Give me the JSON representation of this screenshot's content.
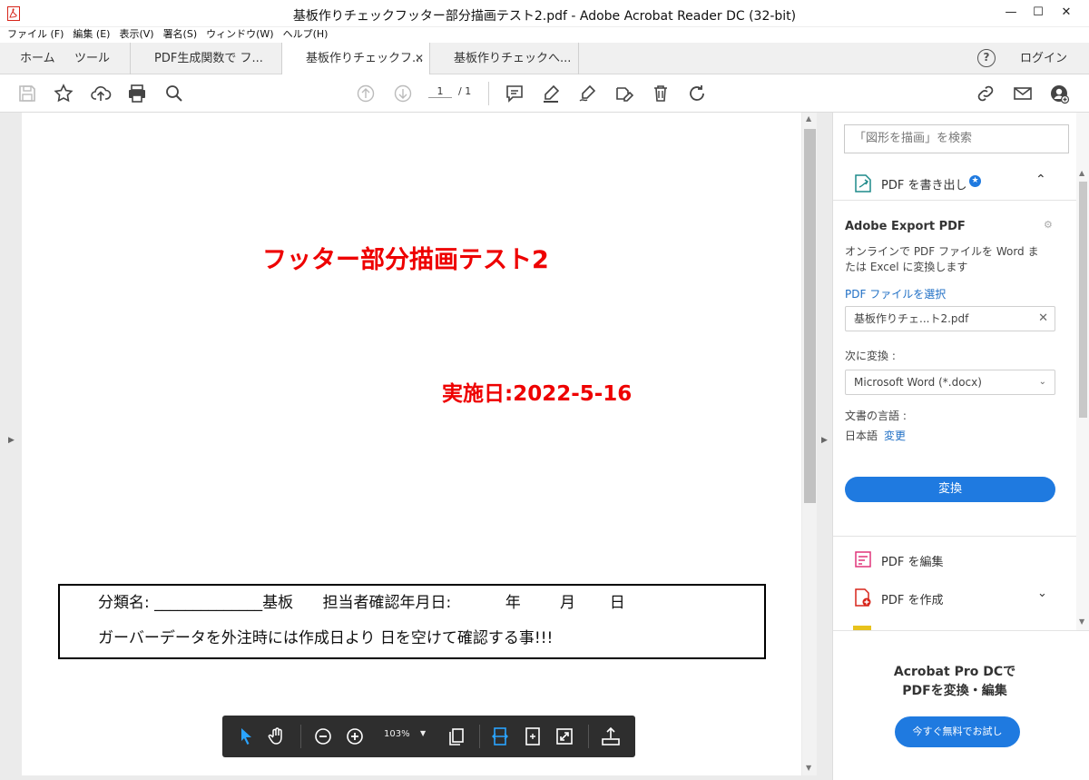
{
  "window": {
    "title": "基板作りチェックフッター部分描画テスト2.pdf - Adobe Acrobat Reader DC (32-bit)",
    "controls": {
      "minimize": "—",
      "maximize": "☐",
      "close": "✕"
    }
  },
  "menu": [
    "ファイル (F)",
    "編集 (E)",
    "表示(V)",
    "署名(S)",
    "ウィンドウ(W)",
    "ヘルプ(H)"
  ],
  "tabs": {
    "home": "ホーム",
    "tools": "ツール",
    "docs": [
      "PDF生成関数で フ...",
      "基板作りチェックフ...",
      "基板作りチェックへ..."
    ],
    "active_index": 1,
    "close_glyph": "✕",
    "help": "?",
    "login": "ログイン"
  },
  "toolbar": {
    "page_current": "1",
    "page_total": "/ 1"
  },
  "document": {
    "heading": "フッター部分描画テスト2",
    "date_line": "実施日:2022-5-16",
    "footer_line1": "分類名: ______________基板      担当者確認年月日:           年        月       日",
    "footer_line2": "ガーバーデータを外注時には作成日より 日を空けて確認する事!!!"
  },
  "float_toolbar": {
    "zoom": "103%"
  },
  "right_panel": {
    "search_placeholder": "「図形を描画」を検索",
    "export_header": "PDF を書き出し",
    "export_title": "Adobe Export PDF",
    "export_desc_1": "オンラインで PDF ファイルを Word ま",
    "export_desc_2": "たは Excel に変換します",
    "select_file_link": "PDF ファイルを選択",
    "selected_file": "基板作りチェ...ト2.pdf",
    "convert_to_label": "次に変換 :",
    "convert_option": "Microsoft Word (*.docx)",
    "language_label": "文書の言語 :",
    "language_value": "日本語",
    "language_change": "変更",
    "convert_button": "変換",
    "tools": [
      "PDF を編集",
      "PDF を作成"
    ],
    "promo_line1": "Acrobat Pro DCで",
    "promo_line2": "PDFを変換・編集",
    "trial_button": "今すぐ無料でお試し"
  },
  "colors": {
    "accent": "#1f7ae0",
    "heading_red": "#ee0000",
    "acrobat_red": "#d7251a"
  }
}
